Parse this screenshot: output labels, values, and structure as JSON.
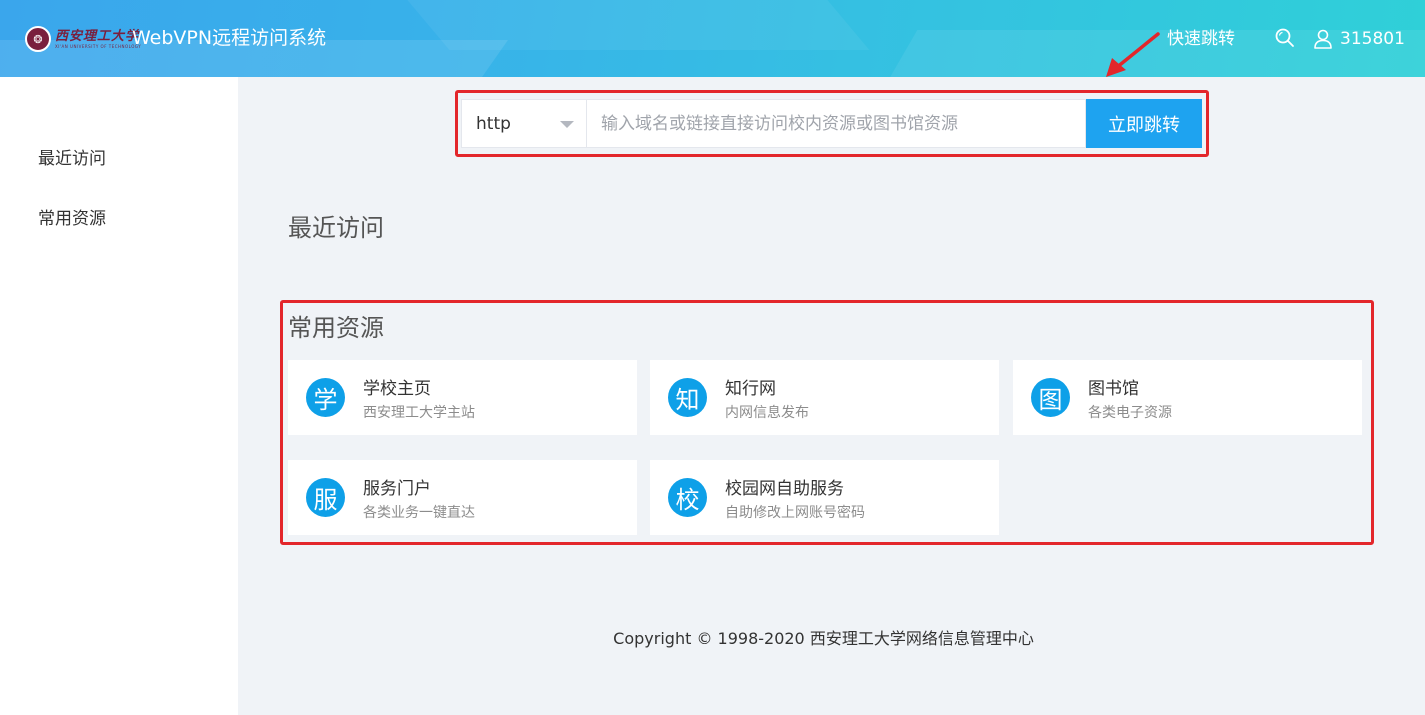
{
  "header": {
    "logo_text": "西安理工大学",
    "logo_subtext": "XI'AN UNIVERSITY OF TECHNOLOGY",
    "app_title": "WebVPN远程访问系统",
    "quick_jump_label": "快速跳转",
    "search_icon": "search-icon",
    "user_icon": "user-icon",
    "user_id": "315801"
  },
  "sidebar": {
    "items": [
      {
        "label": "最近访问"
      },
      {
        "label": "常用资源"
      }
    ]
  },
  "jump_bar": {
    "protocol_selected": "http",
    "url_placeholder": "输入域名或链接直接访问校内资源或图书馆资源",
    "go_button_label": "立即跳转"
  },
  "recent": {
    "title": "最近访问"
  },
  "common": {
    "title": "常用资源",
    "cards": [
      {
        "badge": "学",
        "title": "学校主页",
        "subtitle": "西安理工大学主站"
      },
      {
        "badge": "知",
        "title": "知行网",
        "subtitle": "内网信息发布"
      },
      {
        "badge": "图",
        "title": "图书馆",
        "subtitle": "各类电子资源"
      },
      {
        "badge": "服",
        "title": "服务门户",
        "subtitle": "各类业务一键直达"
      },
      {
        "badge": "校",
        "title": "校园网自助服务",
        "subtitle": "自助修改上网账号密码"
      }
    ]
  },
  "footer": {
    "copyright": "Copyright © 1998-2020 西安理工大学网络信息管理中心"
  },
  "colors": {
    "accent": "#1ea3f0",
    "badge": "#0ea0e8",
    "annotation": "#e3262b"
  }
}
